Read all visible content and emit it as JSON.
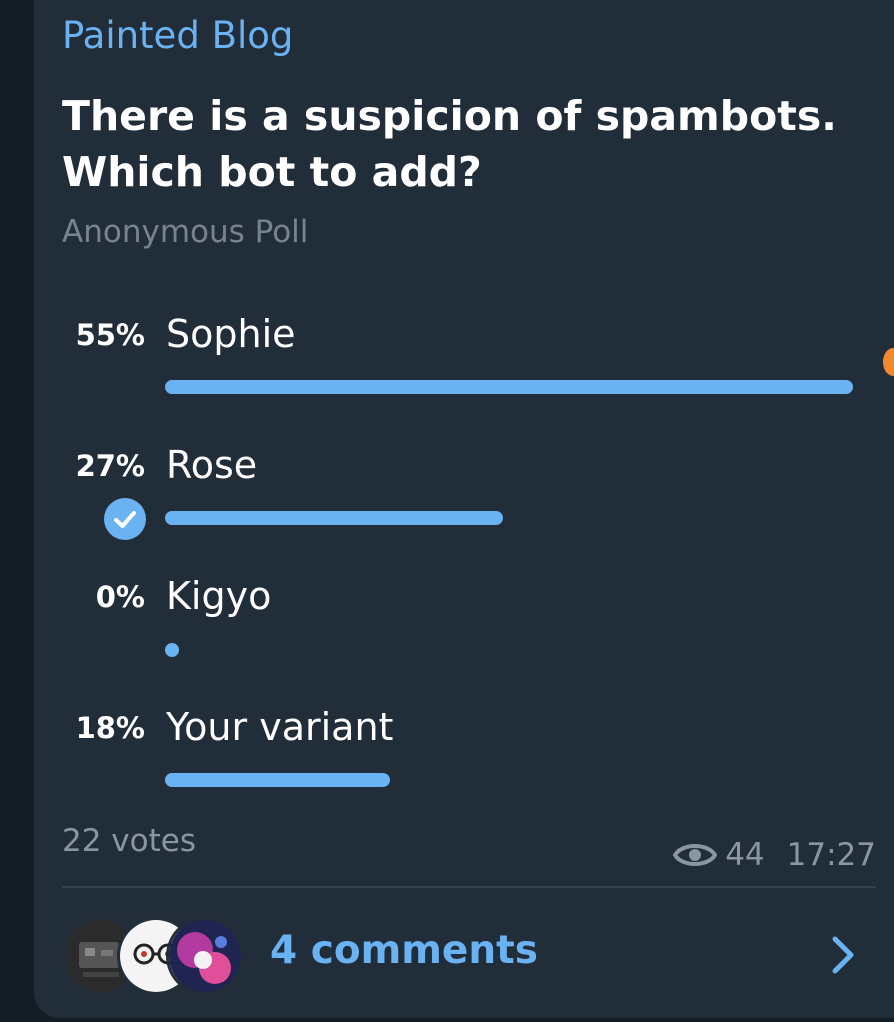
{
  "channel": {
    "name": "Painted Blog"
  },
  "poll": {
    "question": "There is a suspicion of spambots. Which bot to add?",
    "type_label": "Anonymous Poll",
    "options": [
      {
        "percent_label": "55%",
        "label": "Sophie",
        "percent": 55,
        "chosen": false
      },
      {
        "percent_label": "27%",
        "label": "Rose",
        "percent": 27,
        "chosen": true
      },
      {
        "percent_label": "0%",
        "label": "Kigyo",
        "percent": 0,
        "chosen": false
      },
      {
        "percent_label": "18%",
        "label": "Your variant",
        "percent": 18,
        "chosen": false
      }
    ],
    "votes_label": "22 votes"
  },
  "meta": {
    "views": "44",
    "time": "17:27"
  },
  "comments": {
    "label": "4 comments"
  },
  "colors": {
    "accent": "#6ab2f2",
    "card_bg": "#222d3a",
    "page_bg": "#141d26",
    "secondary_text": "#8a96a3"
  },
  "icons": {
    "check": "check-icon",
    "views": "eye-icon",
    "open_comments": "chevron-right-icon"
  }
}
